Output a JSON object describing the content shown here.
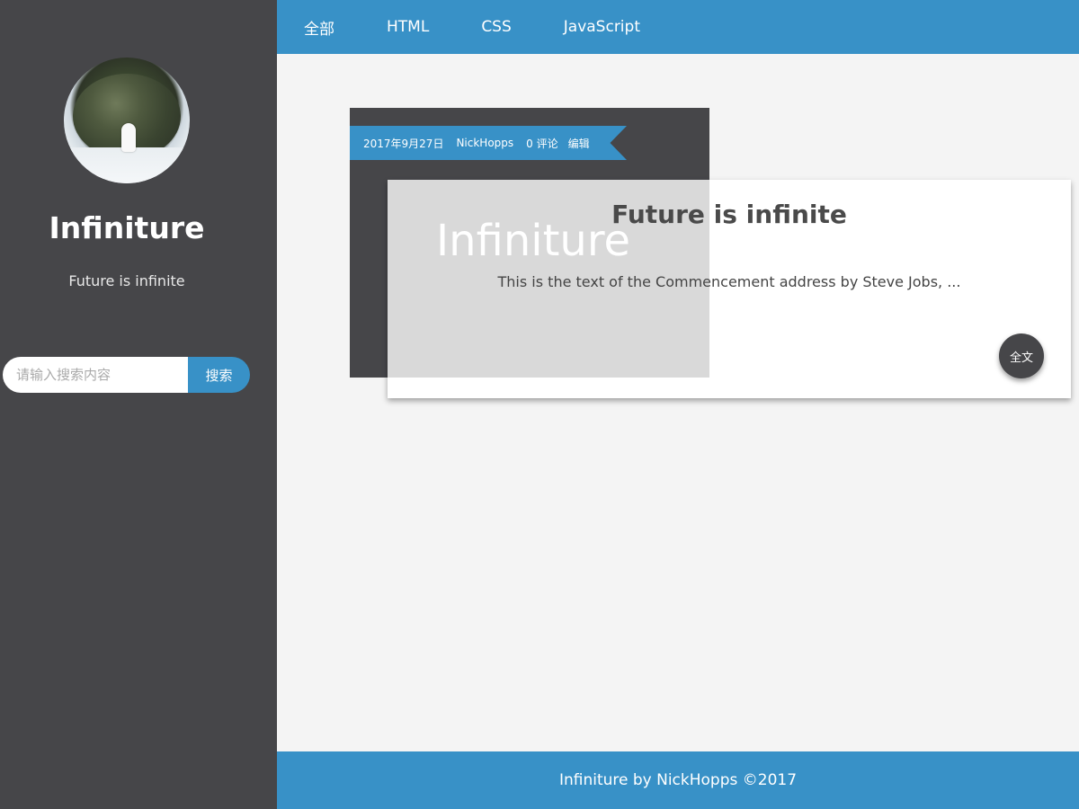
{
  "sidebar": {
    "blog_title": "Infiniture",
    "blog_subtitle": "Future is infinite",
    "search": {
      "placeholder": "请输入搜索内容",
      "value": "",
      "button_label": "搜索"
    }
  },
  "topnav": {
    "items": [
      {
        "label": "全部"
      },
      {
        "label": "HTML"
      },
      {
        "label": "CSS"
      },
      {
        "label": "JavaScript"
      }
    ]
  },
  "post": {
    "meta": {
      "date": "2017年9月27日",
      "author": "NickHopps",
      "comments": "0 评论",
      "edit_label": "编辑"
    },
    "cover_text": "Infiniture",
    "title": "Future is infinite",
    "excerpt": "This is the text of the Commencement address by Steve Jobs, ...",
    "read_more_label": "全文"
  },
  "footer": {
    "text": "Infiniture by NickHopps ©2017"
  },
  "colors": {
    "accent": "#3891c7",
    "sidebar_bg": "#464649",
    "page_bg": "#f4f4f4"
  }
}
